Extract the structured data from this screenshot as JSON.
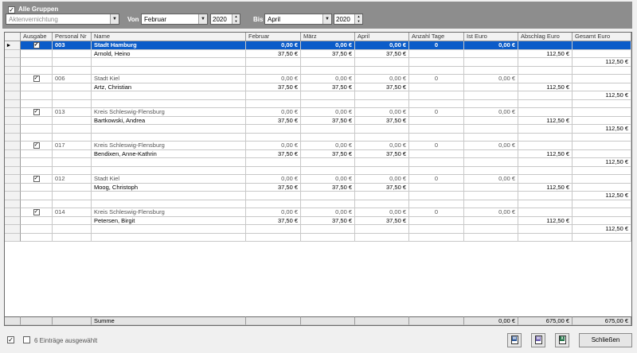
{
  "filter": {
    "all_groups_label": "Alle Gruppen",
    "all_groups_checked": true,
    "group_value": "Aktenvernichtung",
    "from_label": "Von",
    "from_month": "Februar",
    "from_year": "2020",
    "to_label": "Bis",
    "to_month": "April",
    "to_year": "2020"
  },
  "grid": {
    "columns": [
      "Ausgabe",
      "Personal Nr",
      "Name",
      "Februar",
      "März",
      "April",
      "Anzahl Tage",
      "Ist Euro",
      "Abschlag Euro",
      "Gesamt Euro"
    ],
    "groups": [
      {
        "checked": true,
        "nr": "003",
        "name": "Stadt Hamburg",
        "feb": "0,00 €",
        "mar": "0,00 €",
        "apr": "0,00 €",
        "days": "0",
        "ist": "0,00 €",
        "person": "Arnold, Heino",
        "pfeb": "37,50 €",
        "pmar": "37,50 €",
        "papr": "37,50 €",
        "pabschlag": "112,50 €",
        "total": "112,50 €"
      },
      {
        "checked": true,
        "nr": "006",
        "name": "Stadt Kiel",
        "feb": "0,00 €",
        "mar": "0,00 €",
        "apr": "0,00 €",
        "days": "0",
        "ist": "0,00 €",
        "person": "Artz, Christian",
        "pfeb": "37,50 €",
        "pmar": "37,50 €",
        "papr": "37,50 €",
        "pabschlag": "112,50 €",
        "total": "112,50 €"
      },
      {
        "checked": true,
        "nr": "013",
        "name": "Kreis Schleswig-Flensburg",
        "feb": "0,00 €",
        "mar": "0,00 €",
        "apr": "0,00 €",
        "days": "0",
        "ist": "0,00 €",
        "person": "Bartkowski, Andrea",
        "pfeb": "37,50 €",
        "pmar": "37,50 €",
        "papr": "37,50 €",
        "pabschlag": "112,50 €",
        "total": "112,50 €"
      },
      {
        "checked": true,
        "nr": "017",
        "name": "Kreis Schleswig-Flensburg",
        "feb": "0,00 €",
        "mar": "0,00 €",
        "apr": "0,00 €",
        "days": "0",
        "ist": "0,00 €",
        "person": "Bendixen, Anne-Kathrin",
        "pfeb": "37,50 €",
        "pmar": "37,50 €",
        "papr": "37,50 €",
        "pabschlag": "112,50 €",
        "total": "112,50 €"
      },
      {
        "checked": true,
        "nr": "012",
        "name": "Stadt Kiel",
        "feb": "0,00 €",
        "mar": "0,00 €",
        "apr": "0,00 €",
        "days": "0",
        "ist": "0,00 €",
        "person": "Moog, Christoph",
        "pfeb": "37,50 €",
        "pmar": "37,50 €",
        "papr": "37,50 €",
        "pabschlag": "112,50 €",
        "total": "112,50 €"
      },
      {
        "checked": true,
        "nr": "014",
        "name": "Kreis Schleswig-Flensburg",
        "feb": "0,00 €",
        "mar": "0,00 €",
        "apr": "0,00 €",
        "days": "0",
        "ist": "0,00 €",
        "person": "Petersen, Birgit",
        "pfeb": "37,50 €",
        "pmar": "37,50 €",
        "papr": "37,50 €",
        "pabschlag": "112,50 €",
        "total": "112,50 €"
      }
    ],
    "summary": {
      "label": "Summe",
      "ist": "0,00 €",
      "abschlag": "675,00 €",
      "gesamt": "675,00 €"
    }
  },
  "footer": {
    "status_text": "6 Einträge ausgewählt",
    "close_label": "Schließen"
  },
  "icons": {
    "word_icon": "word-icon",
    "word_alt_icon": "word-alt-icon",
    "excel_icon": "excel-icon",
    "row_pointer": "▸"
  },
  "colors": {
    "selection": "#0b5cc9",
    "panel": "#8d8d8d"
  }
}
